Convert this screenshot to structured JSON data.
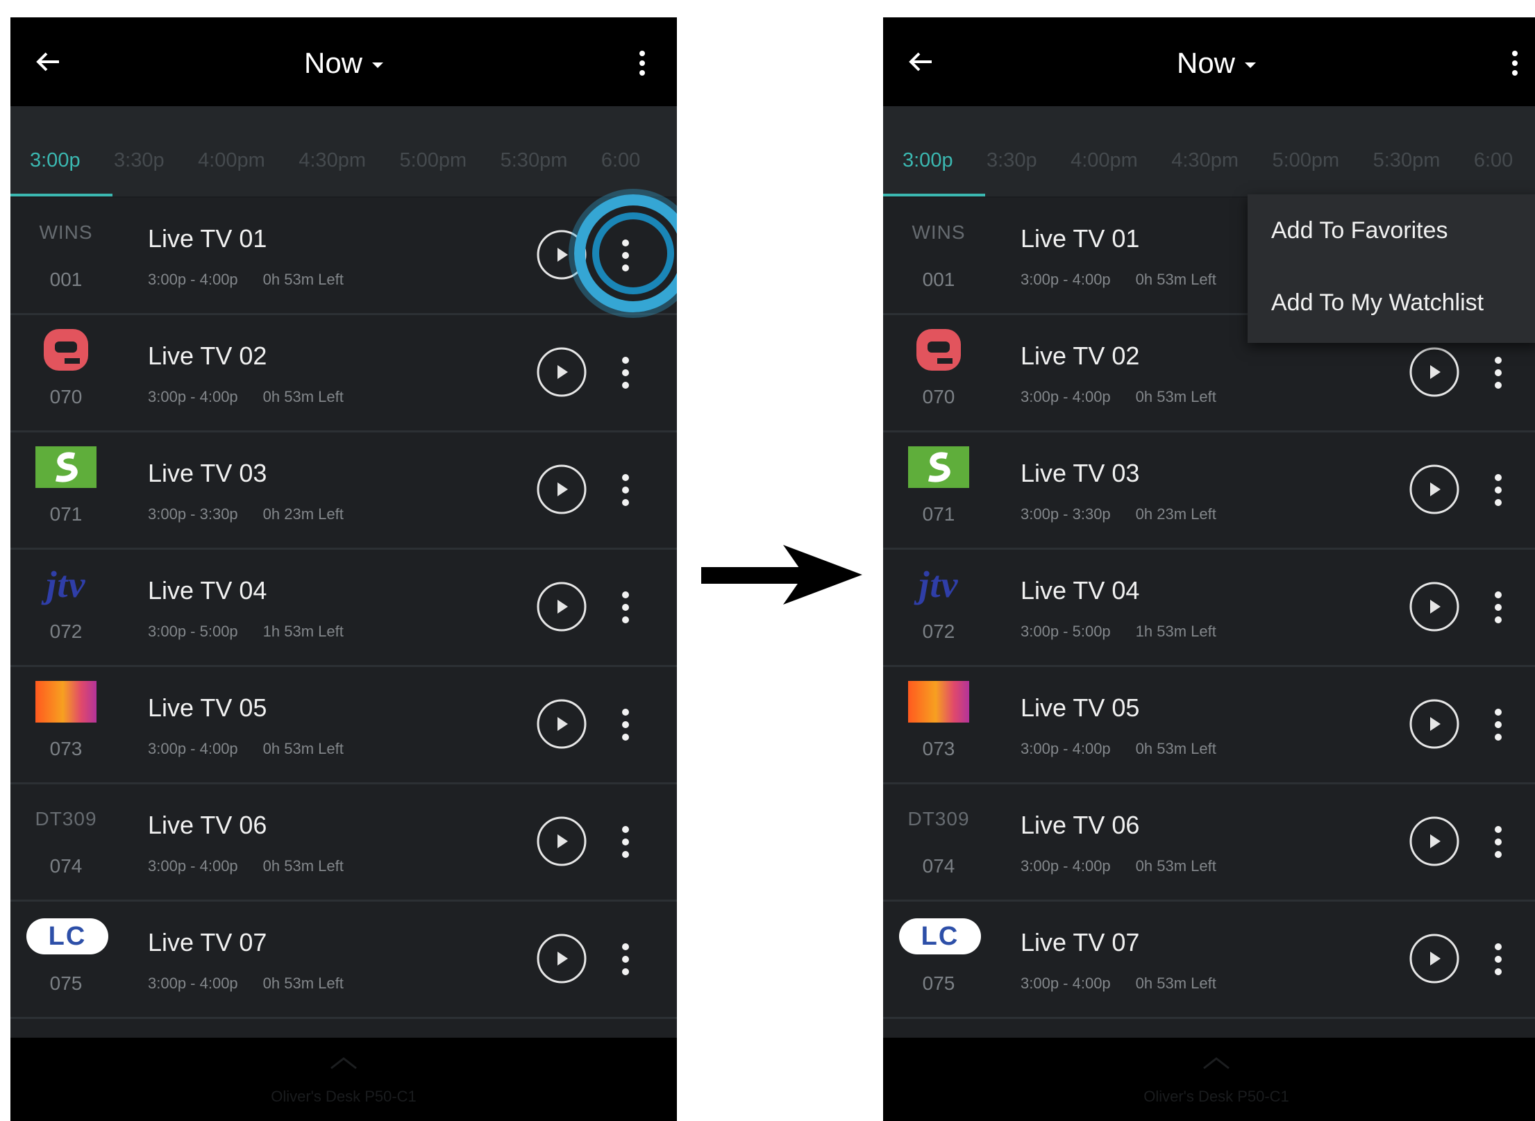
{
  "screens": [
    {
      "id": "before",
      "header": {
        "title": "Now"
      },
      "times": [
        "3:00p",
        "3:30p",
        "4:00pm",
        "4:30pm",
        "5:00pm",
        "5:30pm",
        "6:00"
      ],
      "channels": [
        {
          "logo": "WINS",
          "logo_icon": "wins-text-logo",
          "number": "001",
          "title": "Live TV 01",
          "time": "3:00p - 4:00p",
          "left": "0h 53m Left"
        },
        {
          "logo": "",
          "logo_icon": "q-logo",
          "number": "070",
          "title": "Live TV 02",
          "time": "3:00p - 4:00p",
          "left": "0h 53m Left"
        },
        {
          "logo": "",
          "logo_icon": "green-s-logo",
          "number": "071",
          "title": "Live TV 03",
          "time": "3:00p - 3:30p",
          "left": "0h 23m Left"
        },
        {
          "logo": "jtv",
          "logo_icon": "jtv-logo",
          "number": "072",
          "title": "Live TV 04",
          "time": "3:00p - 5:00p",
          "left": "1h 53m Left"
        },
        {
          "logo": "",
          "logo_icon": "orange-gradient-logo",
          "number": "073",
          "title": "Live TV 05",
          "time": "3:00p - 4:00p",
          "left": "0h 53m Left"
        },
        {
          "logo": "DT309",
          "logo_icon": "dt309-text-logo",
          "number": "074",
          "title": "Live TV 06",
          "time": "3:00p - 4:00p",
          "left": "0h 53m Left"
        },
        {
          "logo": "LC",
          "logo_icon": "lc-logo",
          "number": "075",
          "title": "Live TV 07",
          "time": "3:00p - 4:00p",
          "left": "0h 53m Left"
        }
      ],
      "bottom": {
        "device": "Oliver's Desk P50-C1"
      }
    },
    {
      "id": "after",
      "header": {
        "title": "Now"
      },
      "times": [
        "3:00p",
        "3:30p",
        "4:00pm",
        "4:30pm",
        "5:00pm",
        "5:30pm",
        "6:00"
      ],
      "channels": [
        {
          "logo": "WINS",
          "logo_icon": "wins-text-logo",
          "number": "001",
          "title": "Live TV 01",
          "time": "3:00p - 4:00p",
          "left": "0h 53m Left"
        },
        {
          "logo": "",
          "logo_icon": "q-logo",
          "number": "070",
          "title": "Live TV 02",
          "time": "3:00p - 4:00p",
          "left": "0h 53m Left"
        },
        {
          "logo": "",
          "logo_icon": "green-s-logo",
          "number": "071",
          "title": "Live TV 03",
          "time": "3:00p - 3:30p",
          "left": "0h 23m Left"
        },
        {
          "logo": "jtv",
          "logo_icon": "jtv-logo",
          "number": "072",
          "title": "Live TV 04",
          "time": "3:00p - 5:00p",
          "left": "1h 53m Left"
        },
        {
          "logo": "",
          "logo_icon": "orange-gradient-logo",
          "number": "073",
          "title": "Live TV 05",
          "time": "3:00p - 4:00p",
          "left": "0h 53m Left"
        },
        {
          "logo": "DT309",
          "logo_icon": "dt309-text-logo",
          "number": "074",
          "title": "Live TV 06",
          "time": "3:00p - 4:00p",
          "left": "0h 53m Left"
        },
        {
          "logo": "LC",
          "logo_icon": "lc-logo",
          "number": "075",
          "title": "Live TV 07",
          "time": "3:00p - 4:00p",
          "left": "0h 53m Left"
        }
      ],
      "bottom": {
        "device": "Oliver's Desk P50-C1"
      },
      "popup_menu": {
        "items": [
          "Add To Favorites",
          "Add To My Watchlist"
        ]
      }
    }
  ],
  "colors": {
    "accent": "#3bb8b1",
    "highlight": "#35a6d4",
    "background": "#1b1d20",
    "bar": "#000000"
  },
  "icons": [
    "arrow-left-icon",
    "caret-down-icon",
    "kebab-menu-icon",
    "play-circle-icon",
    "chevron-up-icon",
    "right-arrow-icon"
  ]
}
